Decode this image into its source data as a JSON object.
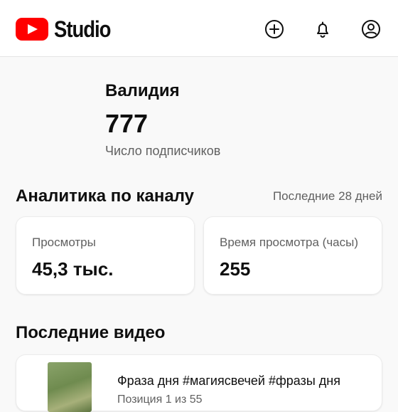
{
  "header": {
    "logo_text": "Studio",
    "icons": [
      "create-icon",
      "notifications-icon",
      "account-icon"
    ]
  },
  "channel": {
    "name": "Валидия",
    "subscribers": "777",
    "subscribers_label": "Число подписчиков"
  },
  "analytics": {
    "title": "Аналитика по каналу",
    "period": "Последние 28 дней",
    "cards": [
      {
        "label": "Просмотры",
        "value": "45,3 тыс."
      },
      {
        "label": "Время просмотра (часы)",
        "value": "255"
      }
    ]
  },
  "recent_videos": {
    "title": "Последние видео",
    "items": [
      {
        "title": "Фраза дня #магиясвечей #фразы дня",
        "meta": "Позиция 1 из 55"
      }
    ]
  },
  "colors": {
    "brand_red": "#ff0000",
    "background": "#f9f9f9",
    "secondary_text": "#606060"
  }
}
